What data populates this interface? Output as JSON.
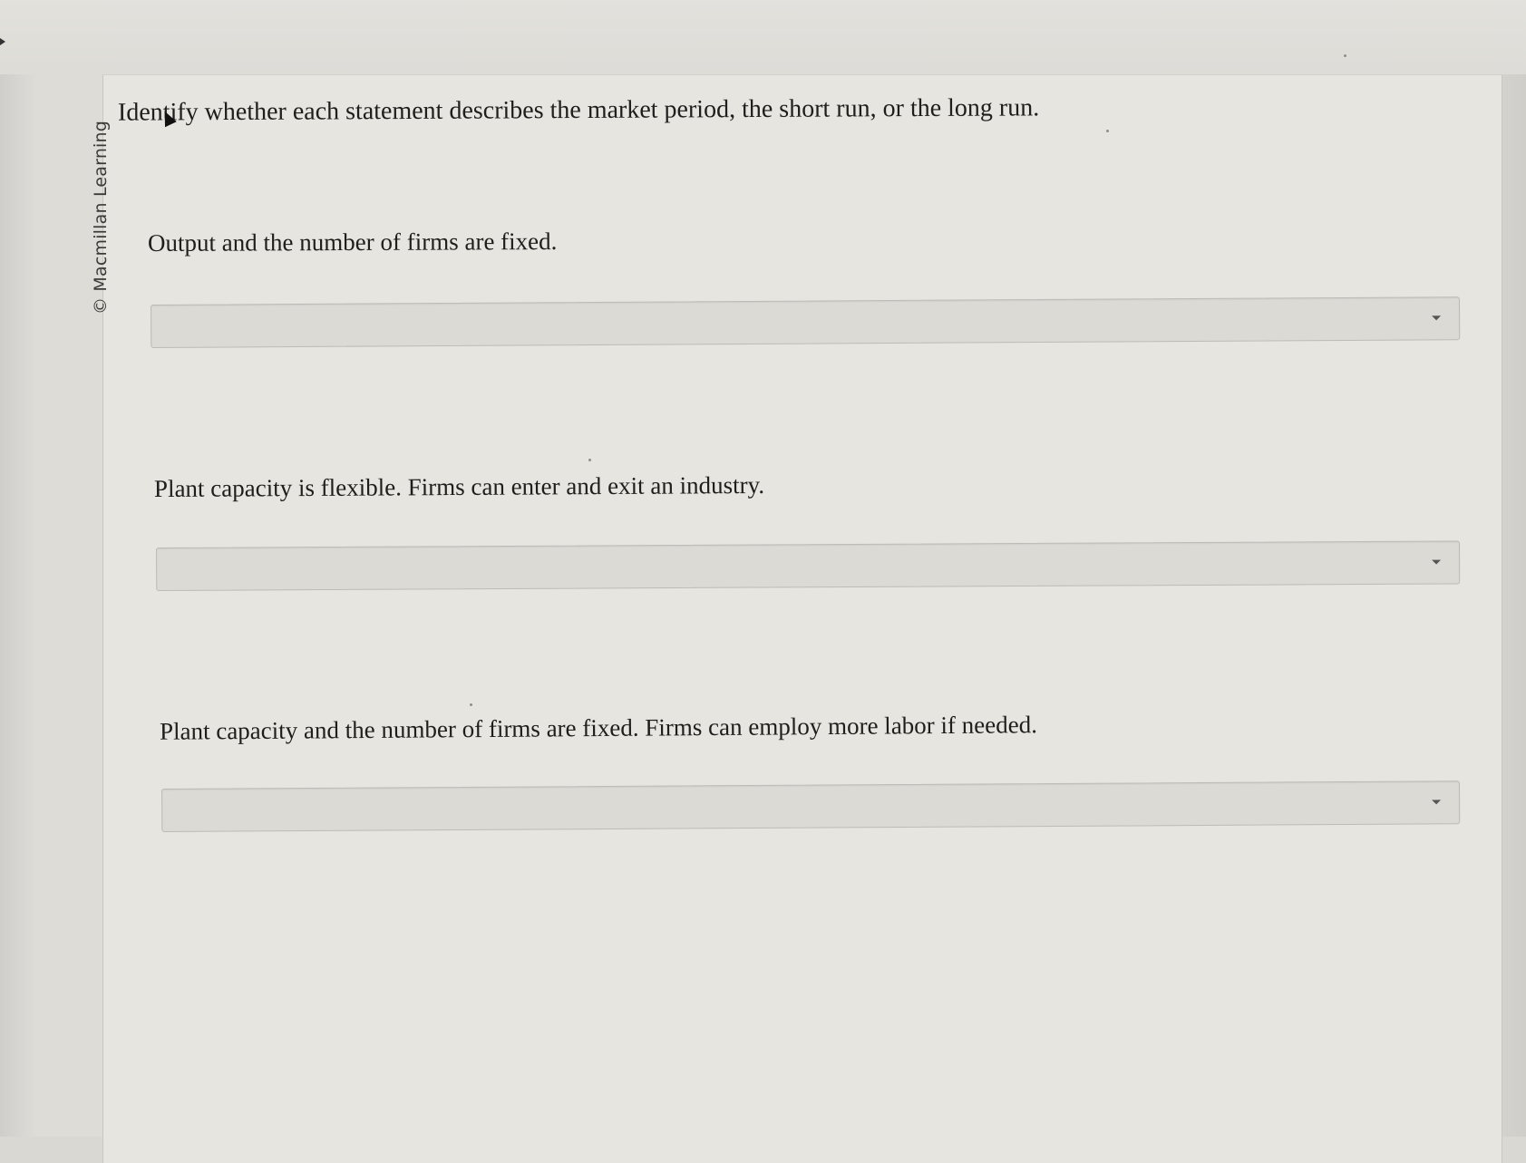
{
  "watermark": {
    "text": "© Macmillan Learning"
  },
  "instructions": "Identify whether each statement describes the market period, the short run, or the long run.",
  "questions": [
    {
      "statement": "Output and the number of firms are fixed.",
      "selected": ""
    },
    {
      "statement": "Plant capacity is flexible. Firms can enter and exit an industry.",
      "selected": ""
    },
    {
      "statement": "Plant capacity and the number of firms are fixed. Firms can employ more labor if needed.",
      "selected": ""
    }
  ],
  "icons": {
    "dropdown": "chevron-down-icon",
    "cursor": "mouse-pointer-icon"
  },
  "colors": {
    "page_background": "#e6e5e0",
    "select_background": "#dbdad5",
    "text": "#1e1e1c"
  }
}
